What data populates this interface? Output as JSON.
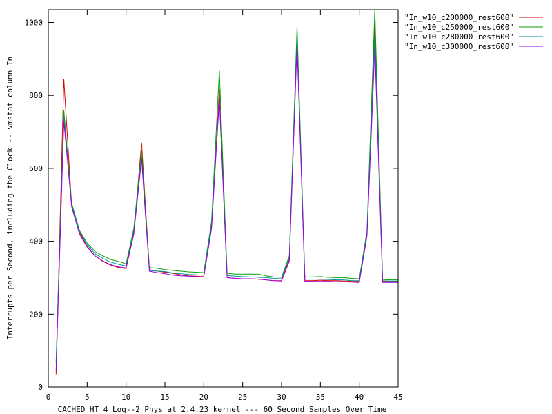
{
  "chart_data": {
    "type": "line",
    "title": "",
    "xlabel": "CACHED HT 4 Log--2 Phys at 2.4.23 kernel --- 60 Second Samples Over Time",
    "ylabel": "Interrupts per Second, including the Clock -- vmstat column In",
    "xlim": [
      0,
      45
    ],
    "ylim": [
      0,
      1035
    ],
    "xticks": [
      0,
      5,
      10,
      15,
      20,
      25,
      30,
      35,
      40,
      45
    ],
    "yticks": [
      0,
      200,
      400,
      600,
      800,
      1000
    ],
    "grid": false,
    "legend_position": "outside-top-right",
    "x": [
      1,
      2,
      3,
      4,
      5,
      6,
      7,
      8,
      9,
      10,
      11,
      12,
      13,
      14,
      15,
      16,
      17,
      18,
      19,
      20,
      21,
      22,
      23,
      24,
      25,
      26,
      27,
      28,
      29,
      30,
      31,
      32,
      33,
      34,
      35,
      36,
      37,
      38,
      39,
      40,
      41,
      42,
      43,
      44,
      45
    ],
    "series": [
      {
        "name": "\"In_w10_c200000_rest600\"",
        "color": "#e00000",
        "values": [
          35,
          845,
          500,
          425,
          385,
          360,
          345,
          335,
          328,
          325,
          420,
          670,
          322,
          318,
          315,
          312,
          308,
          305,
          304,
          303,
          440,
          815,
          300,
          298,
          297,
          297,
          296,
          294,
          292,
          292,
          350,
          965,
          292,
          292,
          293,
          292,
          292,
          291,
          290,
          290,
          420,
          1005,
          290,
          290,
          290
        ]
      },
      {
        "name": "\"In_w10_c250000_rest600\"",
        "color": "#00a000",
        "values": [
          70,
          760,
          505,
          430,
          395,
          372,
          360,
          350,
          345,
          338,
          435,
          650,
          328,
          326,
          322,
          320,
          318,
          316,
          315,
          314,
          455,
          868,
          312,
          310,
          310,
          310,
          310,
          305,
          302,
          301,
          360,
          990,
          302,
          302,
          303,
          301,
          300,
          300,
          298,
          297,
          430,
          1035,
          295,
          294,
          294
        ]
      },
      {
        "name": "\"In_w10_c280000_rest600\"",
        "color": "#00909c",
        "values": [
          65,
          740,
          500,
          428,
          390,
          366,
          353,
          343,
          337,
          332,
          428,
          630,
          320,
          318,
          317,
          313,
          311,
          309,
          308,
          307,
          445,
          795,
          306,
          304,
          303,
          302,
          301,
          300,
          298,
          297,
          355,
          955,
          296,
          296,
          296,
          295,
          294,
          294,
          292,
          292,
          425,
          965,
          292,
          291,
          291
        ]
      },
      {
        "name": "\"In_w10_c300000_rest600\"",
        "color": "#a000e0",
        "values": [
          45,
          730,
          495,
          420,
          384,
          360,
          346,
          336,
          330,
          327,
          420,
          625,
          318,
          314,
          311,
          307,
          305,
          304,
          303,
          302,
          435,
          790,
          300,
          298,
          297,
          297,
          296,
          294,
          292,
          291,
          345,
          940,
          290,
          290,
          290,
          290,
          289,
          289,
          288,
          287,
          415,
          930,
          287,
          287,
          287
        ]
      }
    ]
  }
}
